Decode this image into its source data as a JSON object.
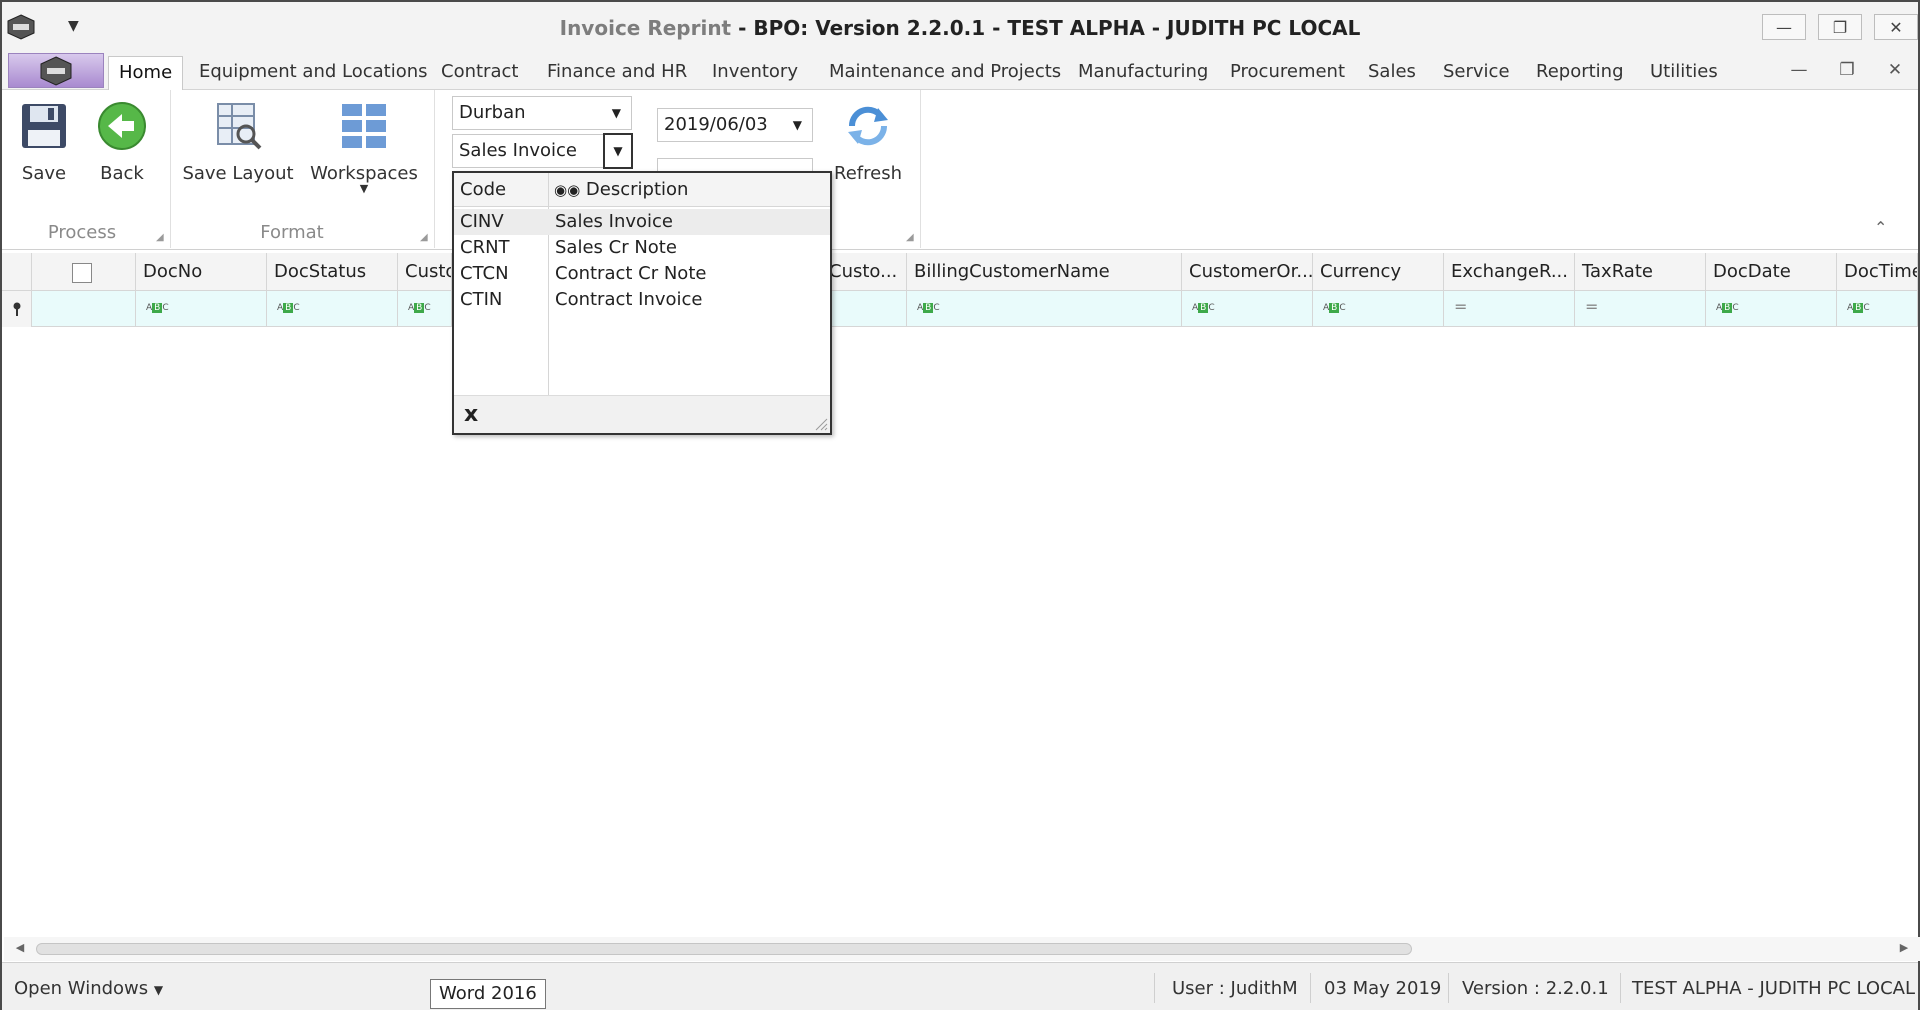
{
  "window": {
    "title_prefix": "Invoice Reprint",
    "title_sep": " - ",
    "title_main": "BPO: Version 2.2.0.1 - TEST ALPHA - JUDITH PC LOCAL",
    "min_icon": "—",
    "restore_icon": "❐",
    "close_icon": "✕"
  },
  "menu": {
    "tabs": [
      "Home",
      "Equipment and Locations",
      "Contract",
      "Finance and HR",
      "Inventory",
      "Maintenance and Projects",
      "Manufacturing",
      "Procurement",
      "Sales",
      "Service",
      "Reporting",
      "Utilities"
    ],
    "active_tab": "Home"
  },
  "ribbon": {
    "save_label": "Save",
    "back_label": "Back",
    "save_layout_label": "Save Layout",
    "workspaces_label": "Workspaces",
    "refresh_label": "Refresh",
    "group_process": "Process",
    "group_format": "Format",
    "site_combo": "Durban",
    "doctype_combo": "Sales Invoice",
    "date_combo": "2019/06/03"
  },
  "grid": {
    "columns": [
      "DocNo",
      "DocStatus",
      "Custo",
      "Custo...",
      "BillingCustomerName",
      "CustomerOr...",
      "Currency",
      "ExchangeR...",
      "TaxRate",
      "DocDate",
      "DocTime"
    ]
  },
  "dropdown": {
    "header_code": "Code",
    "header_description": "Description",
    "rows": [
      {
        "code": "CINV",
        "description": "Sales Invoice"
      },
      {
        "code": "CRNT",
        "description": "Sales Cr Note"
      },
      {
        "code": "CTCN",
        "description": "Contract Cr Note"
      },
      {
        "code": "CTIN",
        "description": "Contract Invoice"
      }
    ],
    "close_label": "x"
  },
  "statusbar": {
    "open_windows": "Open Windows",
    "tooltip": "Word 2016",
    "user": "User : JudithM",
    "date": "03 May 2019",
    "version": "Version : 2.2.0.1",
    "environment": "TEST ALPHA - JUDITH PC LOCAL"
  },
  "colors": {
    "accent_green": "#3ea94a",
    "filter_row": "#e9fbfb",
    "app_button": "#a98ad0"
  }
}
